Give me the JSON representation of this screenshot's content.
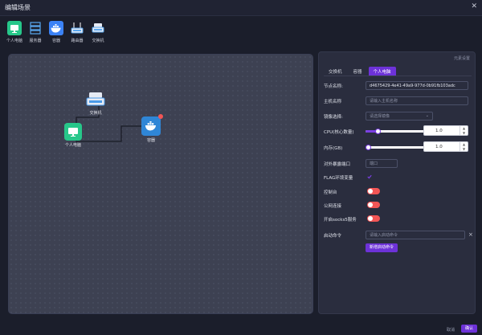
{
  "window": {
    "title": "编辑场景",
    "close": "✕"
  },
  "toolbar": [
    {
      "label": "个人电脑",
      "icon": "pc-icon"
    },
    {
      "label": "服务器",
      "icon": "server-icon"
    },
    {
      "label": "容器",
      "icon": "docker-icon"
    },
    {
      "label": "路由器",
      "icon": "router-icon"
    },
    {
      "label": "交换机",
      "icon": "switch-icon"
    }
  ],
  "canvas": {
    "nodes": [
      {
        "label": "交换机",
        "icon": "switch-icon"
      },
      {
        "label": "个人电脑",
        "icon": "pc-icon"
      },
      {
        "label": "容器",
        "icon": "docker-icon"
      }
    ]
  },
  "panel": {
    "header_link": "元素设置",
    "tabs": [
      "交换机",
      "容器",
      "个人电脑"
    ],
    "active_tab": "个人电脑",
    "node_name": {
      "label": "节点名称:",
      "value": "d4675429-4e41-49a9-977d-0b91fb103adc"
    },
    "host_name": {
      "label": "主机名称",
      "placeholder": "请输入主机名称"
    },
    "image": {
      "label": "镜像选择:",
      "placeholder": "请选择镜像"
    },
    "cpu": {
      "label": "CPU(核心数量)",
      "value": "1.0",
      "level_percent": 20
    },
    "memory": {
      "label": "内存(GB)",
      "value": "1.0",
      "level_percent": 3
    },
    "port": {
      "label": "对外暴露端口",
      "placeholder": "端口"
    },
    "flag": {
      "label": "FLAG环境变量"
    },
    "console": {
      "label": "控制台"
    },
    "public": {
      "label": "公网连接"
    },
    "socks5": {
      "label": "开启socks5服务"
    },
    "startup": {
      "label": "启动命令",
      "placeholder": "请输入启动命令",
      "clear": "×",
      "add_button": "新增启动命令"
    }
  },
  "footer": {
    "cancel": "取消",
    "ok": "确认"
  },
  "colors": {
    "accent": "#6d32d8",
    "toggle_off": "#f25555",
    "pc_green": "#27c78a",
    "docker_blue": "#2f86d6"
  }
}
